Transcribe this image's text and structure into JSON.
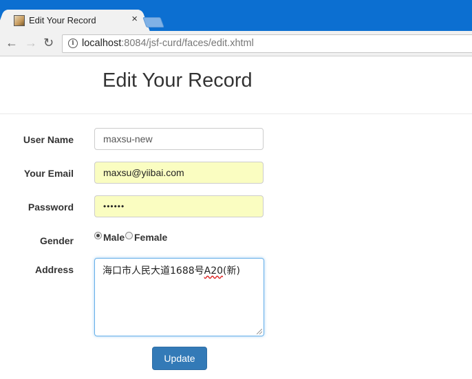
{
  "browser": {
    "tab_title": "Edit Your Record",
    "tab_close": "×",
    "url_host": "localhost",
    "url_rest": ":8084/jsf-curd/faces/edit.xhtml",
    "icons": {
      "back": "arrow-left",
      "forward": "arrow-right",
      "reload": "reload",
      "info": "info"
    }
  },
  "page": {
    "title": "Edit Your Record"
  },
  "form": {
    "username": {
      "label": "User Name",
      "value": "maxsu-new"
    },
    "email": {
      "label": "Your Email",
      "value": "maxsu@yiibai.com"
    },
    "password": {
      "label": "Password",
      "value": "••••••"
    },
    "gender": {
      "label": "Gender",
      "options": [
        "Male",
        "Female"
      ],
      "selected": "Male"
    },
    "address": {
      "label": "Address",
      "value_prefix": "海口市人民大道1688号",
      "value_marked": "A20",
      "value_suffix": "(新)"
    },
    "submit_label": "Update"
  },
  "colors": {
    "titlebar": "#0c6fd1",
    "autofill": "#fafdc1",
    "button": "#337ab7"
  }
}
